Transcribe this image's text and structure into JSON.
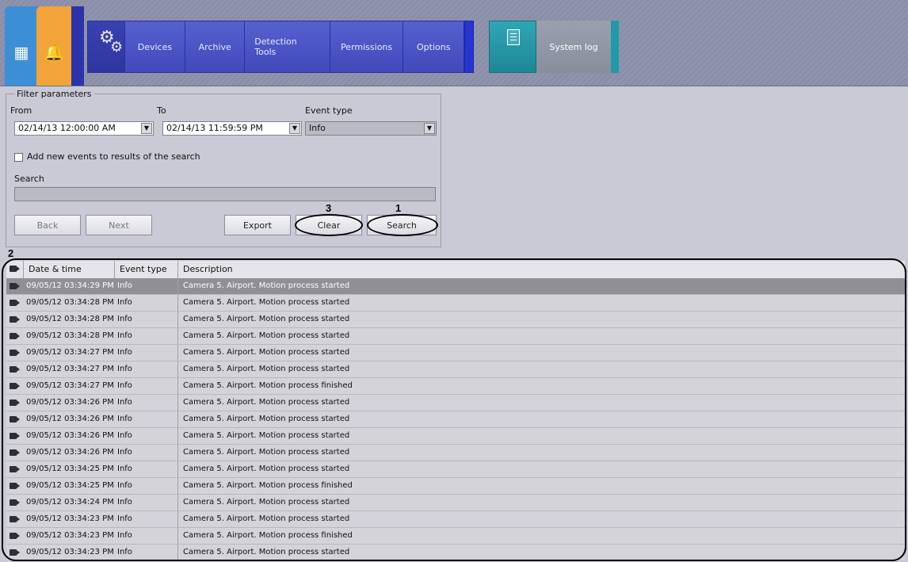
{
  "nav": {
    "tabs": [
      "Devices",
      "Archive",
      "Detection Tools",
      "Permissions",
      "Options"
    ],
    "system_log": "System log"
  },
  "filter": {
    "legend": "Filter parameters",
    "from_label": "From",
    "from_value": "02/14/13 12:00:00 AM",
    "to_label": "To",
    "to_value": "02/14/13 11:59:59 PM",
    "event_type_label": "Event type",
    "event_type_value": "Info",
    "add_new_events_label": "Add new events to results of the search",
    "search_label": "Search",
    "search_value": "",
    "buttons": {
      "back": "Back",
      "next": "Next",
      "export": "Export",
      "clear": "Clear",
      "search": "Search"
    }
  },
  "annotations": {
    "search_marker": "1",
    "table_marker": "2",
    "clear_marker": "3"
  },
  "table": {
    "headers": [
      "Date & time",
      "Event type",
      "Description"
    ],
    "rows": [
      [
        "09/05/12 03:34:29 PM",
        "Info",
        "Camera 5. Airport. Motion process started"
      ],
      [
        "09/05/12 03:34:28 PM",
        "Info",
        "Camera 5. Airport. Motion process started"
      ],
      [
        "09/05/12 03:34:28 PM",
        "Info",
        "Camera 5. Airport. Motion process started"
      ],
      [
        "09/05/12 03:34:28 PM",
        "Info",
        "Camera 5. Airport. Motion process started"
      ],
      [
        "09/05/12 03:34:27 PM",
        "Info",
        "Camera 5. Airport. Motion process started"
      ],
      [
        "09/05/12 03:34:27 PM",
        "Info",
        "Camera 5. Airport. Motion process started"
      ],
      [
        "09/05/12 03:34:27 PM",
        "Info",
        "Camera 5. Airport. Motion process finished"
      ],
      [
        "09/05/12 03:34:26 PM",
        "Info",
        "Camera 5. Airport. Motion process started"
      ],
      [
        "09/05/12 03:34:26 PM",
        "Info",
        "Camera 5. Airport. Motion process started"
      ],
      [
        "09/05/12 03:34:26 PM",
        "Info",
        "Camera 5. Airport. Motion process started"
      ],
      [
        "09/05/12 03:34:26 PM",
        "Info",
        "Camera 5. Airport. Motion process started"
      ],
      [
        "09/05/12 03:34:25 PM",
        "Info",
        "Camera 5. Airport. Motion process started"
      ],
      [
        "09/05/12 03:34:25 PM",
        "Info",
        "Camera 5. Airport. Motion process finished"
      ],
      [
        "09/05/12 03:34:24 PM",
        "Info",
        "Camera 5. Airport. Motion process started"
      ],
      [
        "09/05/12 03:34:23 PM",
        "Info",
        "Camera 5. Airport. Motion process started"
      ],
      [
        "09/05/12 03:34:23 PM",
        "Info",
        "Camera 5. Airport. Motion process finished"
      ],
      [
        "09/05/12 03:34:23 PM",
        "Info",
        "Camera 5. Airport. Motion process started"
      ]
    ]
  },
  "colors": {
    "accent_blue": "#3d45b6",
    "teal": "#1e8796",
    "orange": "#f2a43a",
    "selected_row": "#8f8f95"
  }
}
